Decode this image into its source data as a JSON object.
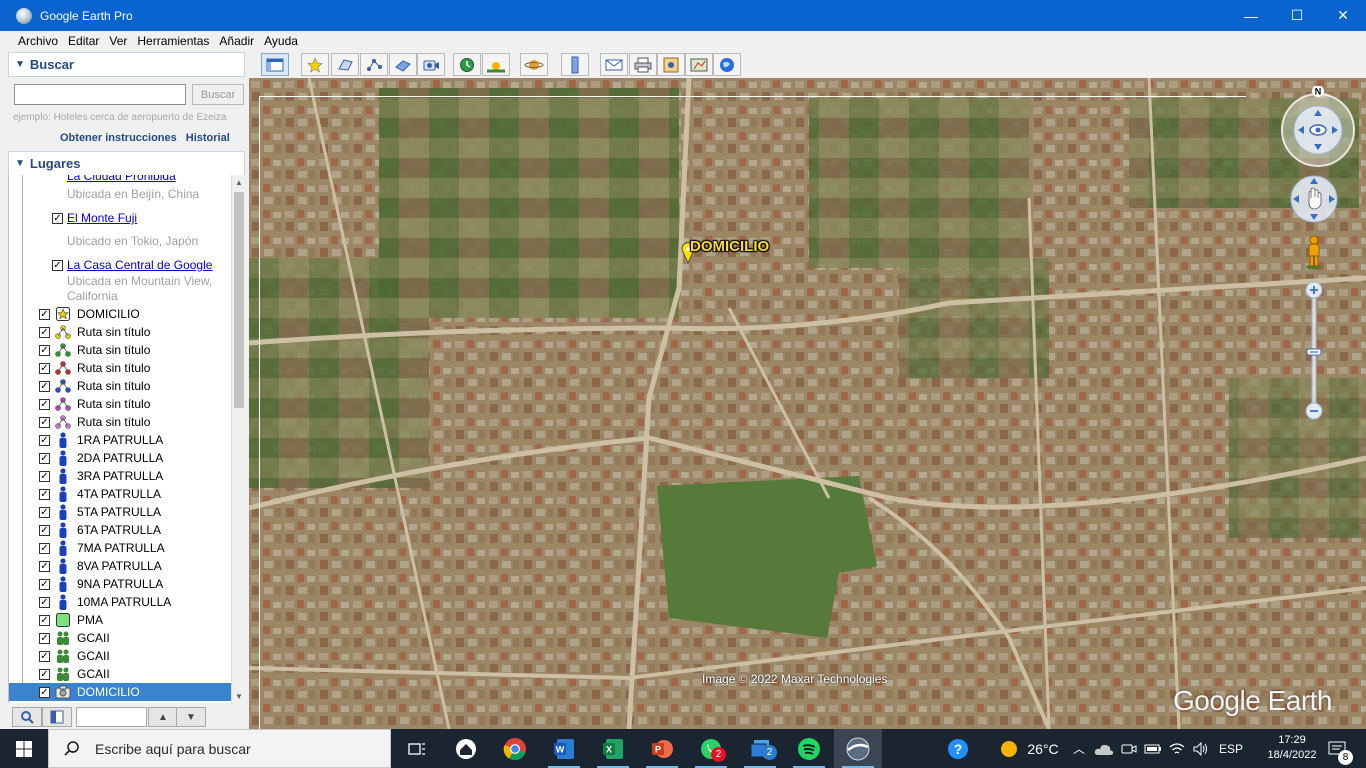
{
  "window": {
    "title": "Google Earth Pro",
    "controls": {
      "minimize": "—",
      "maximize": "☐",
      "close": "✕"
    }
  },
  "menu": [
    "Archivo",
    "Editar",
    "Ver",
    "Herramientas",
    "Añadir",
    "Ayuda"
  ],
  "search_panel": {
    "title": "Buscar",
    "input_value": "",
    "button_label": "Buscar",
    "hint": "ejemplo: Hoteles cerca de aeropuerto de Ezeiza",
    "directions_link": "Obtener instrucciones",
    "history_link": "Historial"
  },
  "places_panel": {
    "title": "Lugares",
    "items": [
      {
        "label": "La Ciudad Prohibida",
        "type": "link",
        "checked": true,
        "sub": "Ubicada en Beijín, China"
      },
      {
        "label": "El Monte Fuji",
        "type": "link",
        "checked": true,
        "sub": "Ubicado en Tokio, Japón"
      },
      {
        "label": "La Casa Central de Google",
        "type": "link",
        "checked": true,
        "sub": "Ubicada en Mountain View,",
        "sub2": "California"
      },
      {
        "label": "DOMICILIO",
        "icon": "star-placemark-icon",
        "checked": true
      },
      {
        "label": "Ruta sin título",
        "icon": "path-icon",
        "color": "#e8d800",
        "checked": true
      },
      {
        "label": "Ruta sin título",
        "icon": "path-icon",
        "color": "#2ca02c",
        "checked": true
      },
      {
        "label": "Ruta sin título",
        "icon": "path-icon",
        "color": "#d62728",
        "checked": true
      },
      {
        "label": "Ruta sin título",
        "icon": "path-icon",
        "color": "#1f4fd6",
        "checked": true
      },
      {
        "label": "Ruta sin título",
        "icon": "path-icon",
        "color": "#c040d0",
        "checked": true
      },
      {
        "label": "Ruta sin título",
        "icon": "path-icon",
        "color": "#c040d0",
        "checked": true
      },
      {
        "label": "1RA PATRULLA",
        "icon": "person-icon",
        "checked": true
      },
      {
        "label": "2DA PATRULLA",
        "icon": "person-icon",
        "checked": true
      },
      {
        "label": "3RA PATRULLA",
        "icon": "person-icon",
        "checked": true
      },
      {
        "label": "4TA PATRULLA",
        "icon": "person-icon",
        "checked": true
      },
      {
        "label": "5TA PATRULLA",
        "icon": "person-icon",
        "checked": true
      },
      {
        "label": "6TA PATRULLA",
        "icon": "person-icon",
        "checked": true
      },
      {
        "label": "7MA PATRULLA",
        "icon": "person-icon",
        "checked": true
      },
      {
        "label": "8VA PATRULLA",
        "icon": "person-icon",
        "checked": true
      },
      {
        "label": "9NA PATRULLA",
        "icon": "person-icon",
        "checked": true
      },
      {
        "label": "10MA PATRULLA",
        "icon": "person-icon",
        "checked": true
      },
      {
        "label": "PMA",
        "icon": "square-icon",
        "checked": true
      },
      {
        "label": "GCAII",
        "icon": "group-icon",
        "checked": true
      },
      {
        "label": "GCAII",
        "icon": "group-icon",
        "checked": true
      },
      {
        "label": "GCAII",
        "icon": "group-icon",
        "checked": true
      },
      {
        "label": "DOMICILIO",
        "icon": "camera-icon",
        "checked": true,
        "selected": true
      }
    ]
  },
  "map": {
    "placemark_label": "DOMICILIO",
    "attribution": "Image © 2022 Maxar Technologies",
    "logo_text": "Google Earth",
    "north_label": "N"
  },
  "taskbar": {
    "search_placeholder": "Escribe aquí para buscar",
    "weather": "26°C",
    "language": "ESP",
    "time": "17:29",
    "date": "18/4/2022",
    "whatsapp_badge": "2",
    "notifications_badge": "8"
  },
  "colors": {
    "titlebar": "#0a64d0",
    "panel_title": "#244a84",
    "selection": "#3a83cf",
    "placemark_label": "#ffde22",
    "taskbar": "#1b2431"
  }
}
